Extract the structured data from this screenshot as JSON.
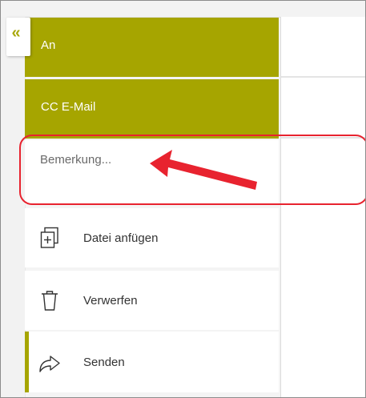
{
  "collapse": {
    "glyph": "«"
  },
  "fields": {
    "to_label": "An",
    "cc_label": "CC E-Mail",
    "remark_placeholder": "Bemerkung..."
  },
  "actions": [
    {
      "label": "Datei anfügen",
      "icon": "attach-file-icon"
    },
    {
      "label": "Verwerfen",
      "icon": "trash-icon"
    },
    {
      "label": "Senden",
      "icon": "send-arrow-icon"
    }
  ],
  "colors": {
    "accent": "#a6a500",
    "annotation": "#e8232f"
  }
}
